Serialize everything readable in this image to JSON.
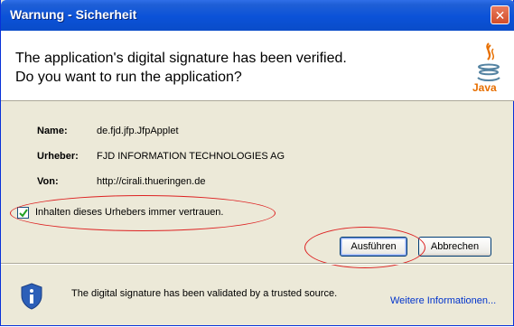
{
  "window": {
    "title": "Warnung - Sicherheit",
    "close_symbol": "✕"
  },
  "header": {
    "line1": "The application's digital signature has been verified.",
    "line2": "Do you want to run the application?",
    "logo_text": "Java",
    "logo_icon": "java-cup-icon"
  },
  "details": [
    {
      "label": "Name:",
      "value": "de.fjd.jfp.JfpApplet"
    },
    {
      "label": "Urheber:",
      "value": "FJD INFORMATION TECHNOLOGIES AG"
    },
    {
      "label": "Von:",
      "value": "http://cirali.thueringen.de"
    }
  ],
  "trust_checkbox": {
    "label": "Inhalten dieses Urhebers immer vertrauen.",
    "checked": true
  },
  "buttons": {
    "run": "Ausführen",
    "cancel": "Abbrechen"
  },
  "footer": {
    "icon": "shield-info-icon",
    "message": "The digital signature has been validated by a trusted source.",
    "more_info": "Weitere Informationen..."
  },
  "colors": {
    "titlebar": "#0b52d8",
    "annotation_red": "#dd2222",
    "java_orange": "#e76f00",
    "link": "#0033cc"
  }
}
